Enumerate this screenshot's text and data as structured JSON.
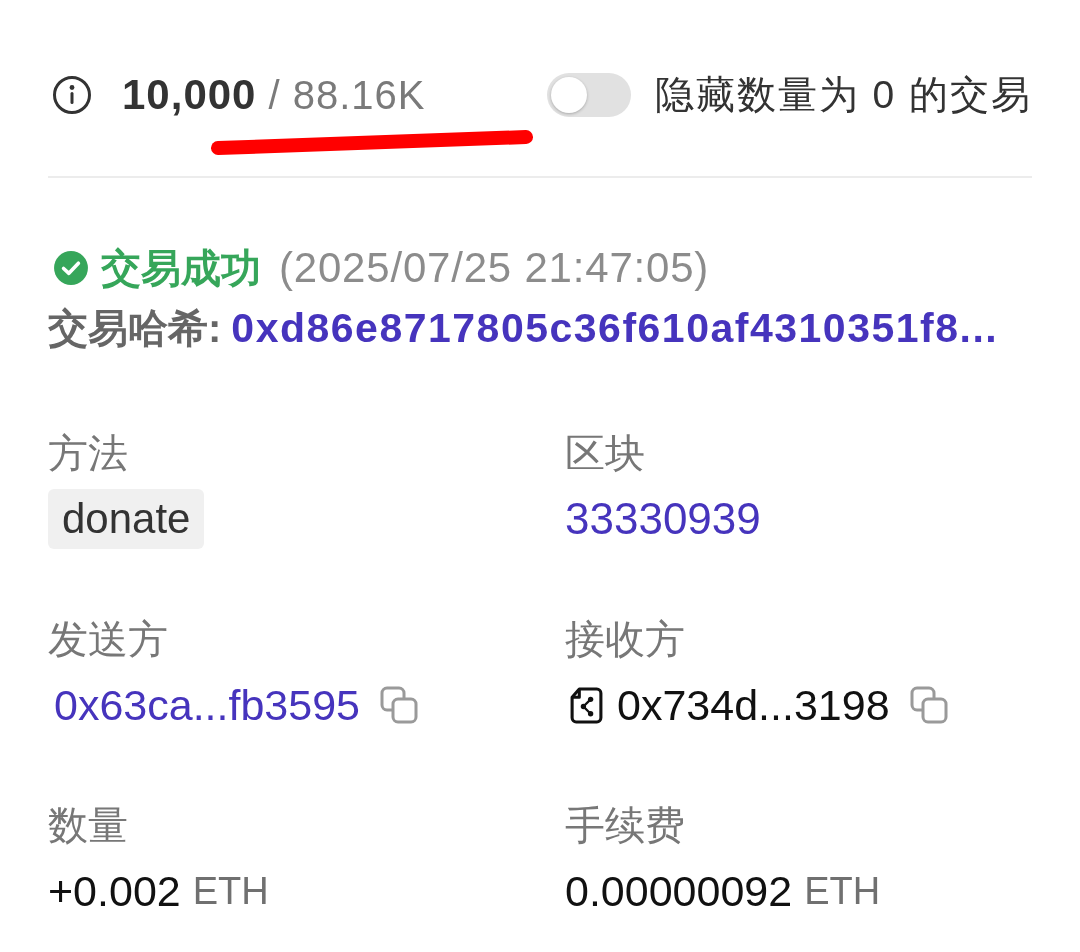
{
  "summary": {
    "count": "10,000",
    "total": "/ 88.16K"
  },
  "hide_zero_toggle": {
    "label": "隐藏数量为 0 的交易",
    "on": false
  },
  "transaction": {
    "status": {
      "kind": "success",
      "text": "交易成功"
    },
    "timestamp": "(2025/07/25 21:47:05)",
    "hash_label": "交易哈希:",
    "hash": "0xd86e8717805c36f610af4310351f8...",
    "fields": [
      {
        "label": "方法",
        "kind": "method",
        "value": "donate"
      },
      {
        "label": "区块",
        "kind": "link",
        "value": "33330939"
      },
      {
        "label": "发送方",
        "kind": "address",
        "contract": false,
        "value": "0x63ca...fb3595"
      },
      {
        "label": "接收方",
        "kind": "address",
        "contract": true,
        "value": "0x734d...3198"
      },
      {
        "label": "数量",
        "kind": "amount",
        "value": "+0.002",
        "unit": "ETH"
      },
      {
        "label": "手续费",
        "kind": "amount",
        "value": "0.00000092",
        "unit": "ETH"
      }
    ]
  }
}
